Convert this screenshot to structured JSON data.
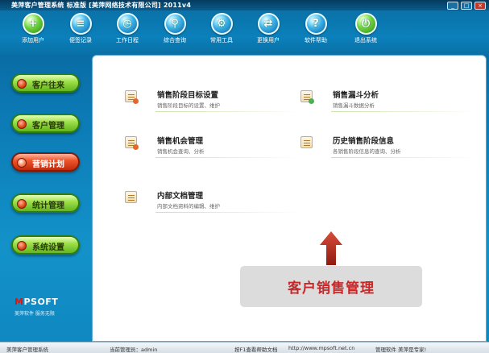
{
  "window": {
    "title": "美萍客户管理系统 标准版 [美萍网络技术有限公司] 2011v4",
    "minimize_glyph": "_",
    "maximize_glyph": "□",
    "close_glyph": "×"
  },
  "toolbar": {
    "items": [
      {
        "label": "添加用户",
        "icon": "add-user-icon",
        "glyph": "+"
      },
      {
        "label": "便签记录",
        "icon": "memo-icon",
        "glyph": "≡"
      },
      {
        "label": "工作日程",
        "icon": "calendar-icon",
        "glyph": "◷"
      },
      {
        "label": "综合查询",
        "icon": "search-icon",
        "glyph": "⚲"
      },
      {
        "label": "常用工具",
        "icon": "tools-icon",
        "glyph": "⚙"
      },
      {
        "label": "更换用户",
        "icon": "switch-user-icon",
        "glyph": "⇄"
      },
      {
        "label": "软件帮助",
        "icon": "help-icon",
        "glyph": "?"
      },
      {
        "label": "退出系统",
        "icon": "power-icon",
        "glyph": "⏻"
      }
    ]
  },
  "nav": {
    "items": [
      {
        "label": "客户往来",
        "active": false
      },
      {
        "label": "客户管理",
        "active": false
      },
      {
        "label": "营销计划",
        "active": true
      },
      {
        "label": "统计管理",
        "active": false
      },
      {
        "label": "系统设置",
        "active": false
      }
    ]
  },
  "logo": {
    "brand_red": "M",
    "brand_rest": "PSOFT",
    "slogan": "美萍软件 服务无限"
  },
  "content": {
    "items": [
      {
        "name": "销售阶段目标设置",
        "desc": "销售阶段目标的设置、维护"
      },
      {
        "name": "销售漏斗分析",
        "desc": "销售漏斗数据分析"
      },
      {
        "name": "销售机会管理",
        "desc": "销售机会查询、分析"
      },
      {
        "name": "历史销售阶段信息",
        "desc": "各销售阶段信息的查询、分析"
      },
      {
        "name": "内部文档管理",
        "desc": "内部文档资料的编辑、维护"
      }
    ],
    "callout": "客户销售管理"
  },
  "status": {
    "app": "美萍客户管理系统",
    "operator": "当前管理员：admin",
    "help": "按F1查看帮助文档",
    "url": "http://www.mpsoft.net.cn",
    "slogan": "管理软件 美萍是专家!"
  },
  "colors": {
    "accent_red": "#c62828",
    "nav_green": "#62b51f",
    "nav_active": "#f0552a",
    "background_blue": "#0b78b3"
  }
}
